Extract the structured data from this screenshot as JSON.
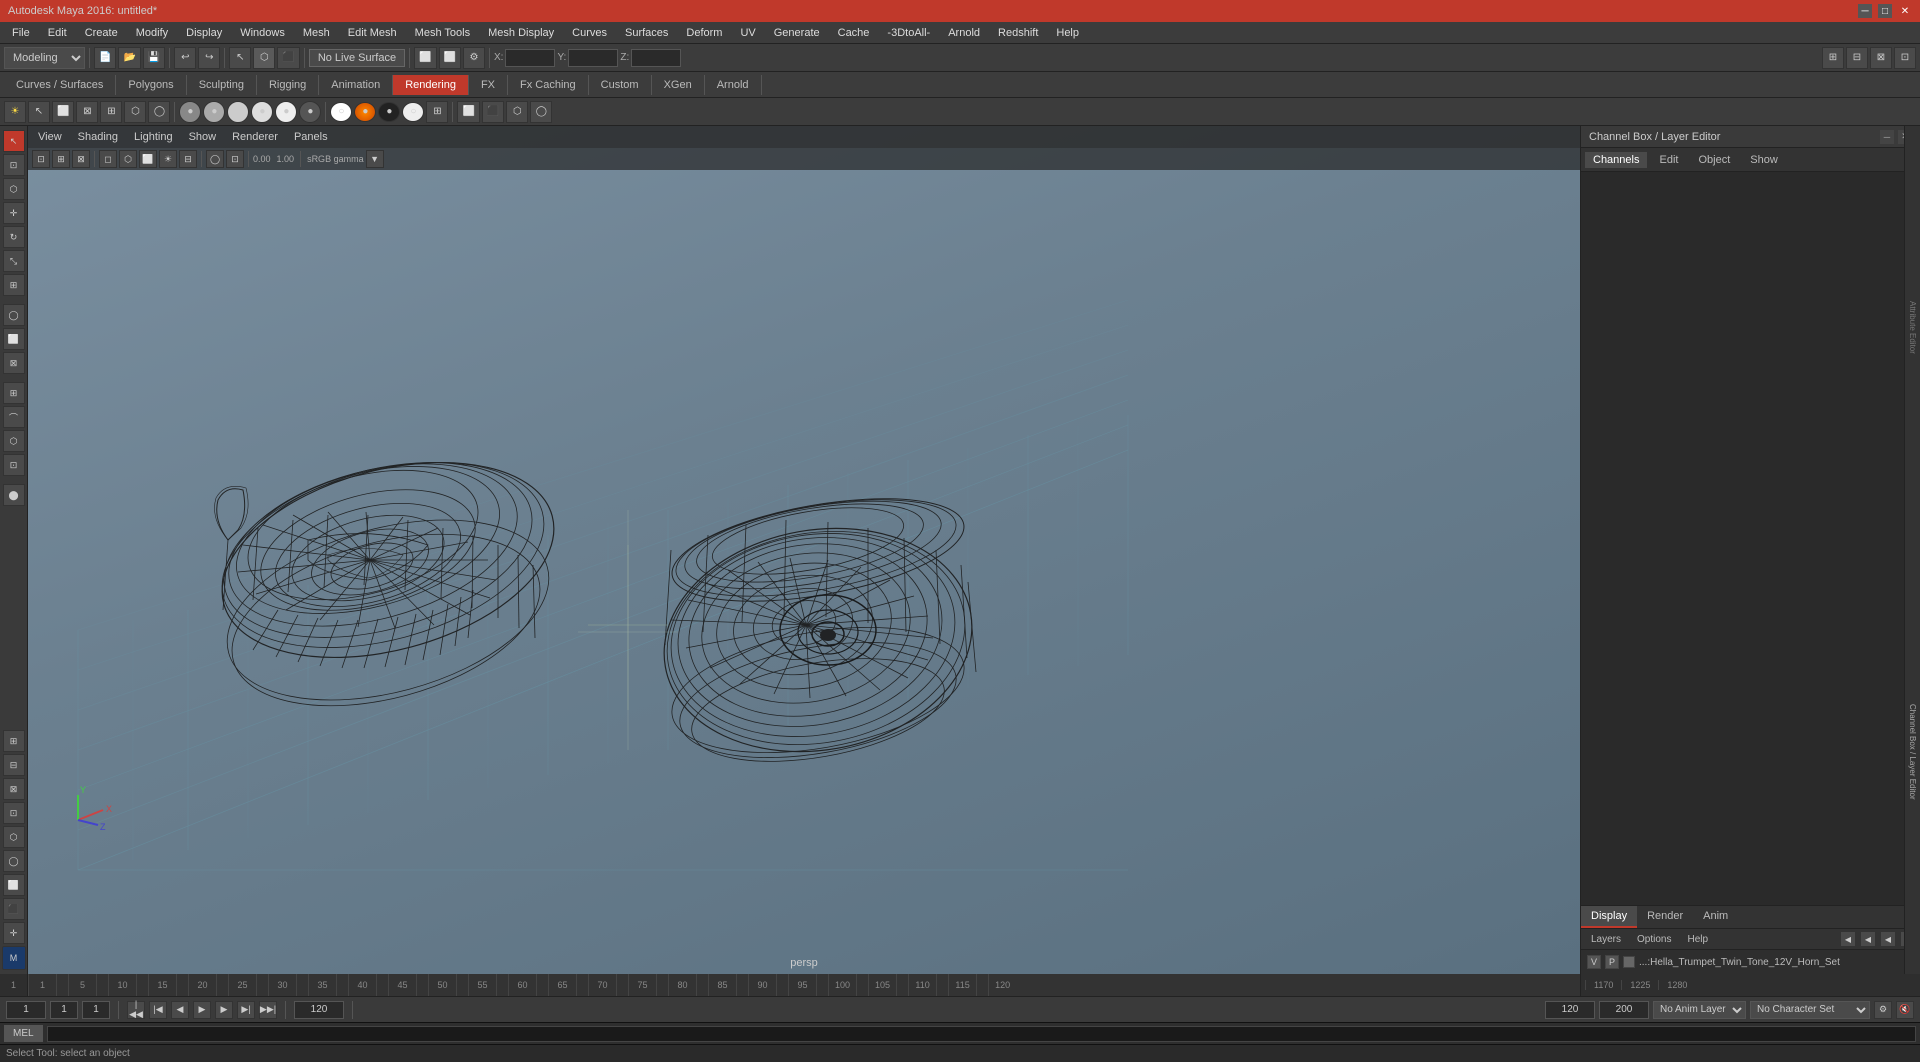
{
  "app": {
    "title": "Autodesk Maya 2016: untitled*",
    "window_controls": [
      "minimize",
      "maximize",
      "close"
    ]
  },
  "menu_bar": {
    "items": [
      "File",
      "Edit",
      "Create",
      "Modify",
      "Display",
      "Windows",
      "Mesh",
      "Edit Mesh",
      "Mesh Tools",
      "Mesh Display",
      "Curves",
      "Surfaces",
      "Deform",
      "UV",
      "Generate",
      "Cache",
      "-3DtoAll-",
      "Arnold",
      "Redshift",
      "Help"
    ]
  },
  "toolbar1": {
    "mode_dropdown": "Modeling",
    "no_live_surface": "No Live Surface",
    "xyz_labels": [
      "X:",
      "Y:",
      "Z:"
    ]
  },
  "mode_tabs": {
    "items": [
      "Curves / Surfaces",
      "Polygons",
      "Sculpting",
      "Rigging",
      "Animation",
      "Rendering",
      "FX",
      "Fx Caching",
      "Custom",
      "XGen",
      "Arnold"
    ],
    "active": "Rendering"
  },
  "viewport": {
    "menu_items": [
      "View",
      "Shading",
      "Lighting",
      "Show",
      "Renderer",
      "Panels"
    ],
    "persp_label": "persp",
    "gamma_label": "sRGB gamma",
    "origin_label": "+"
  },
  "right_panel": {
    "header": "Channel Box / Layer Editor",
    "tabs": [
      "Channels",
      "Edit",
      "Object",
      "Show"
    ],
    "attr_tabs": [
      "Attribute Editor",
      "Channel Box / Layer Editor"
    ]
  },
  "layer_editor": {
    "tabs": [
      "Display",
      "Render",
      "Anim"
    ],
    "active_tab": "Display",
    "sub_tabs": [
      "Layers",
      "Options",
      "Help"
    ],
    "layers": [
      {
        "visible": "V",
        "p": "P",
        "color": "#888",
        "name": "...:Hella_Trumpet_Twin_Tone_12V_Horn_Set"
      }
    ]
  },
  "timeline": {
    "ticks": [
      "1",
      "",
      "5",
      "",
      "10",
      "",
      "15",
      "",
      "20",
      "",
      "25",
      "",
      "30",
      "",
      "35",
      "",
      "40",
      "",
      "45",
      "",
      "50",
      "",
      "55",
      "",
      "60",
      "",
      "65",
      "",
      "70",
      "",
      "75",
      "",
      "80",
      "",
      "85",
      "",
      "90",
      "",
      "95",
      "",
      "100",
      "",
      "105",
      "",
      "110",
      "",
      "115",
      "",
      "120"
    ],
    "right_ticks": [
      "1170",
      "",
      "1225",
      "",
      "1280"
    ]
  },
  "bottom_bar": {
    "frame_current": "1",
    "frame_step": "1",
    "frame_display": "1",
    "range_end": "120",
    "range_end2": "120",
    "range_end3": "200",
    "anim_layer": "No Anim Layer",
    "character_set": "No Character Set",
    "playback_buttons": [
      "<<",
      "<|",
      "<",
      "▶",
      ">",
      "|>",
      ">>"
    ]
  },
  "command_line": {
    "tab": "MEL",
    "status": "Select Tool: select an object"
  },
  "icons": {
    "select": "↖",
    "lasso": "∿",
    "paint": "⬜",
    "move": "✛",
    "rotate": "↻",
    "scale": "⤡",
    "snap_grid": "⊞",
    "snap_curve": "⌒",
    "search": "⌕",
    "gear": "⚙",
    "close": "✕",
    "minimize": "─",
    "maximize": "□"
  }
}
